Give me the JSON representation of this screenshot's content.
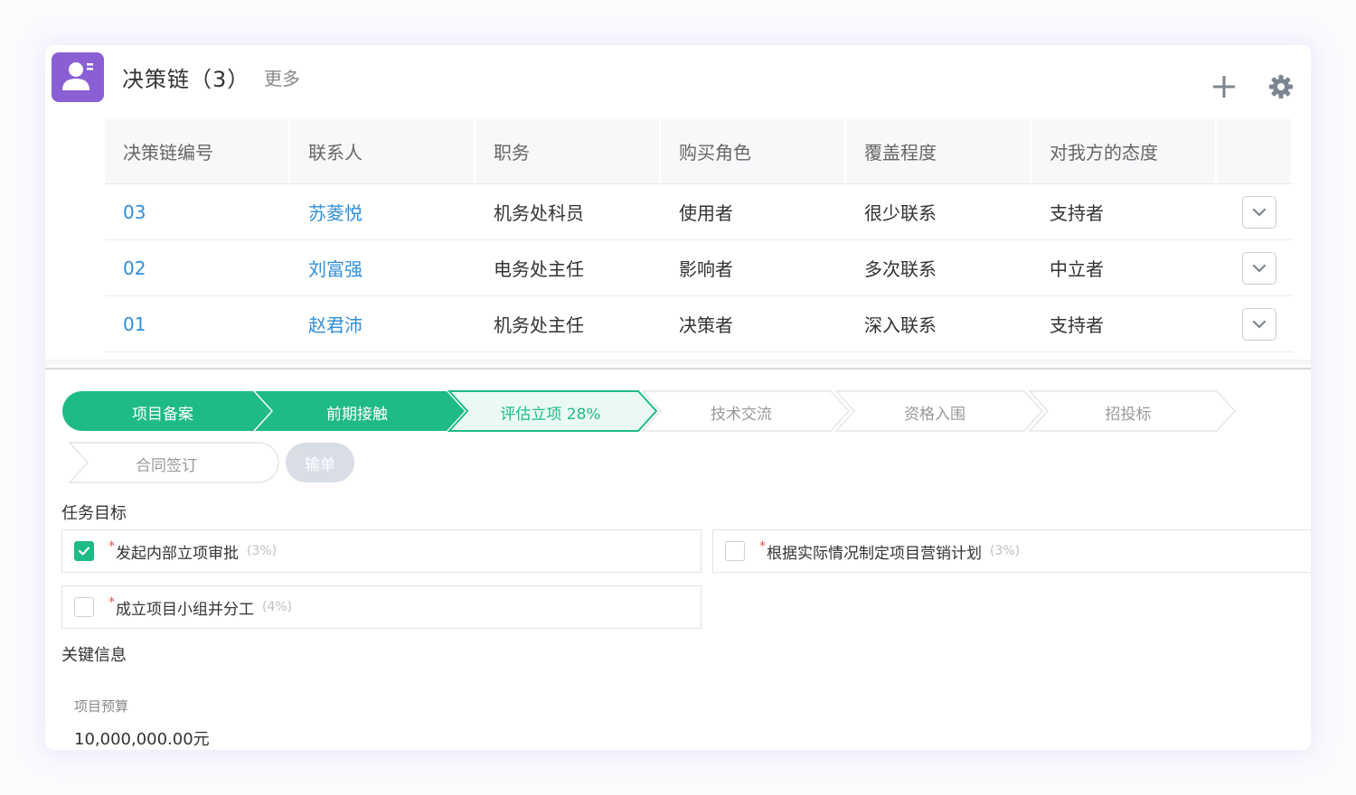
{
  "header": {
    "icon": "contact-card-icon",
    "title": "决策链（3）",
    "more_label": "更多",
    "add_icon": "plus-icon",
    "settings_icon": "gear-icon",
    "accent_color": "#8a5fd3"
  },
  "table": {
    "columns": [
      "决策链编号",
      "联系人",
      "职务",
      "购买角色",
      "覆盖程度",
      "对我方的态度"
    ],
    "rows": [
      {
        "id": "03",
        "contact": "苏菱悦",
        "title": "机务处科员",
        "role": "使用者",
        "coverage": "很少联系",
        "attitude": "支持者"
      },
      {
        "id": "02",
        "contact": "刘富强",
        "title": "电务处主任",
        "role": "影响者",
        "coverage": "多次联系",
        "attitude": "中立者"
      },
      {
        "id": "01",
        "contact": "赵君沛",
        "title": "机务处主任",
        "role": "决策者",
        "coverage": "深入联系",
        "attitude": "支持者"
      }
    ],
    "row_action_icon": "chevron-down-icon",
    "link_color": "#2f8fd8"
  },
  "stages": {
    "items": [
      {
        "label": "项目备案",
        "status": "done"
      },
      {
        "label": "前期接触",
        "status": "done"
      },
      {
        "label": "评估立项 28%",
        "status": "current"
      },
      {
        "label": "技术交流",
        "status": "todo"
      },
      {
        "label": "资格入围",
        "status": "todo"
      },
      {
        "label": "招投标",
        "status": "todo"
      },
      {
        "label": "合同签订",
        "status": "todo"
      }
    ],
    "lose_label": "输单",
    "done_color": "#1fbb85"
  },
  "tasks": {
    "section_title": "任务目标",
    "required_mark": "*",
    "items": [
      {
        "name": "发起内部立项审批",
        "percent": "(3%)",
        "checked": true
      },
      {
        "name": "根据实际情况制定项目营销计划",
        "percent": "(3%)",
        "checked": false
      },
      {
        "name": "成立项目小组并分工",
        "percent": "(4%)",
        "checked": false
      }
    ]
  },
  "key_info": {
    "section_title": "关键信息",
    "budget_label": "项目预算",
    "budget_value": "10,000,000.00元"
  }
}
